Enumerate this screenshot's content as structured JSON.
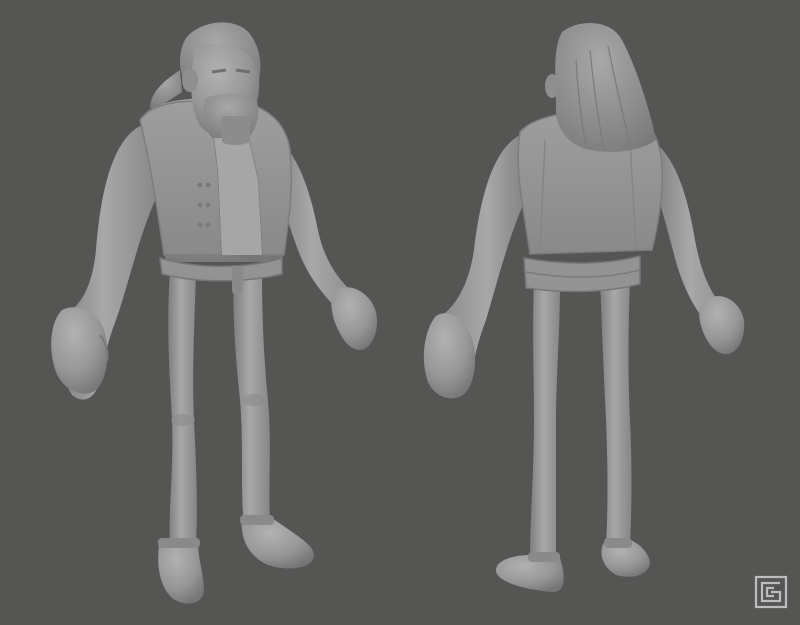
{
  "scene": {
    "background_color": "#555554",
    "model_color": "#9a9a9a",
    "model_shadow_color": "#7d7d7d",
    "model_highlight_color": "#b4b4b4"
  },
  "views": [
    {
      "name": "front-three-quarter-view",
      "subject": "character-sculpt"
    },
    {
      "name": "back-three-quarter-view",
      "subject": "character-sculpt"
    }
  ],
  "watermark": {
    "logo": "artist-monogram-logo",
    "color": "#bdbdbd"
  }
}
